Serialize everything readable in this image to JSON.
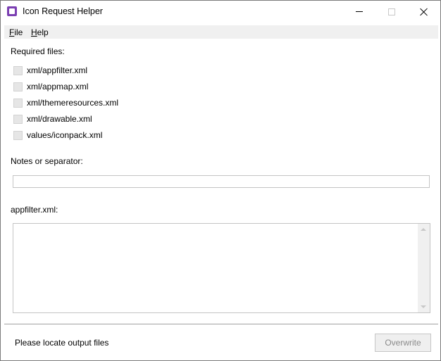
{
  "window": {
    "title": "Icon Request Helper"
  },
  "menu": {
    "file_mnemonic": "F",
    "file_rest": "ile",
    "help_mnemonic": "H",
    "help_rest": "elp"
  },
  "required_files": {
    "label": "Required files:",
    "items": [
      {
        "label": "xml/appfilter.xml",
        "checked": false
      },
      {
        "label": "xml/appmap.xml",
        "checked": false
      },
      {
        "label": "xml/themeresources.xml",
        "checked": false
      },
      {
        "label": "xml/drawable.xml",
        "checked": false
      },
      {
        "label": "values/iconpack.xml",
        "checked": false
      }
    ]
  },
  "notes": {
    "label": "Notes or separator:",
    "value": ""
  },
  "appfilter": {
    "label": "appfilter.xml:",
    "value": ""
  },
  "footer": {
    "status": "Please locate output files",
    "overwrite_label": "Overwrite"
  },
  "icons": {
    "app": "purple-square-icon",
    "minimize": "minimize-icon",
    "maximize": "maximize-icon",
    "close": "close-icon"
  }
}
